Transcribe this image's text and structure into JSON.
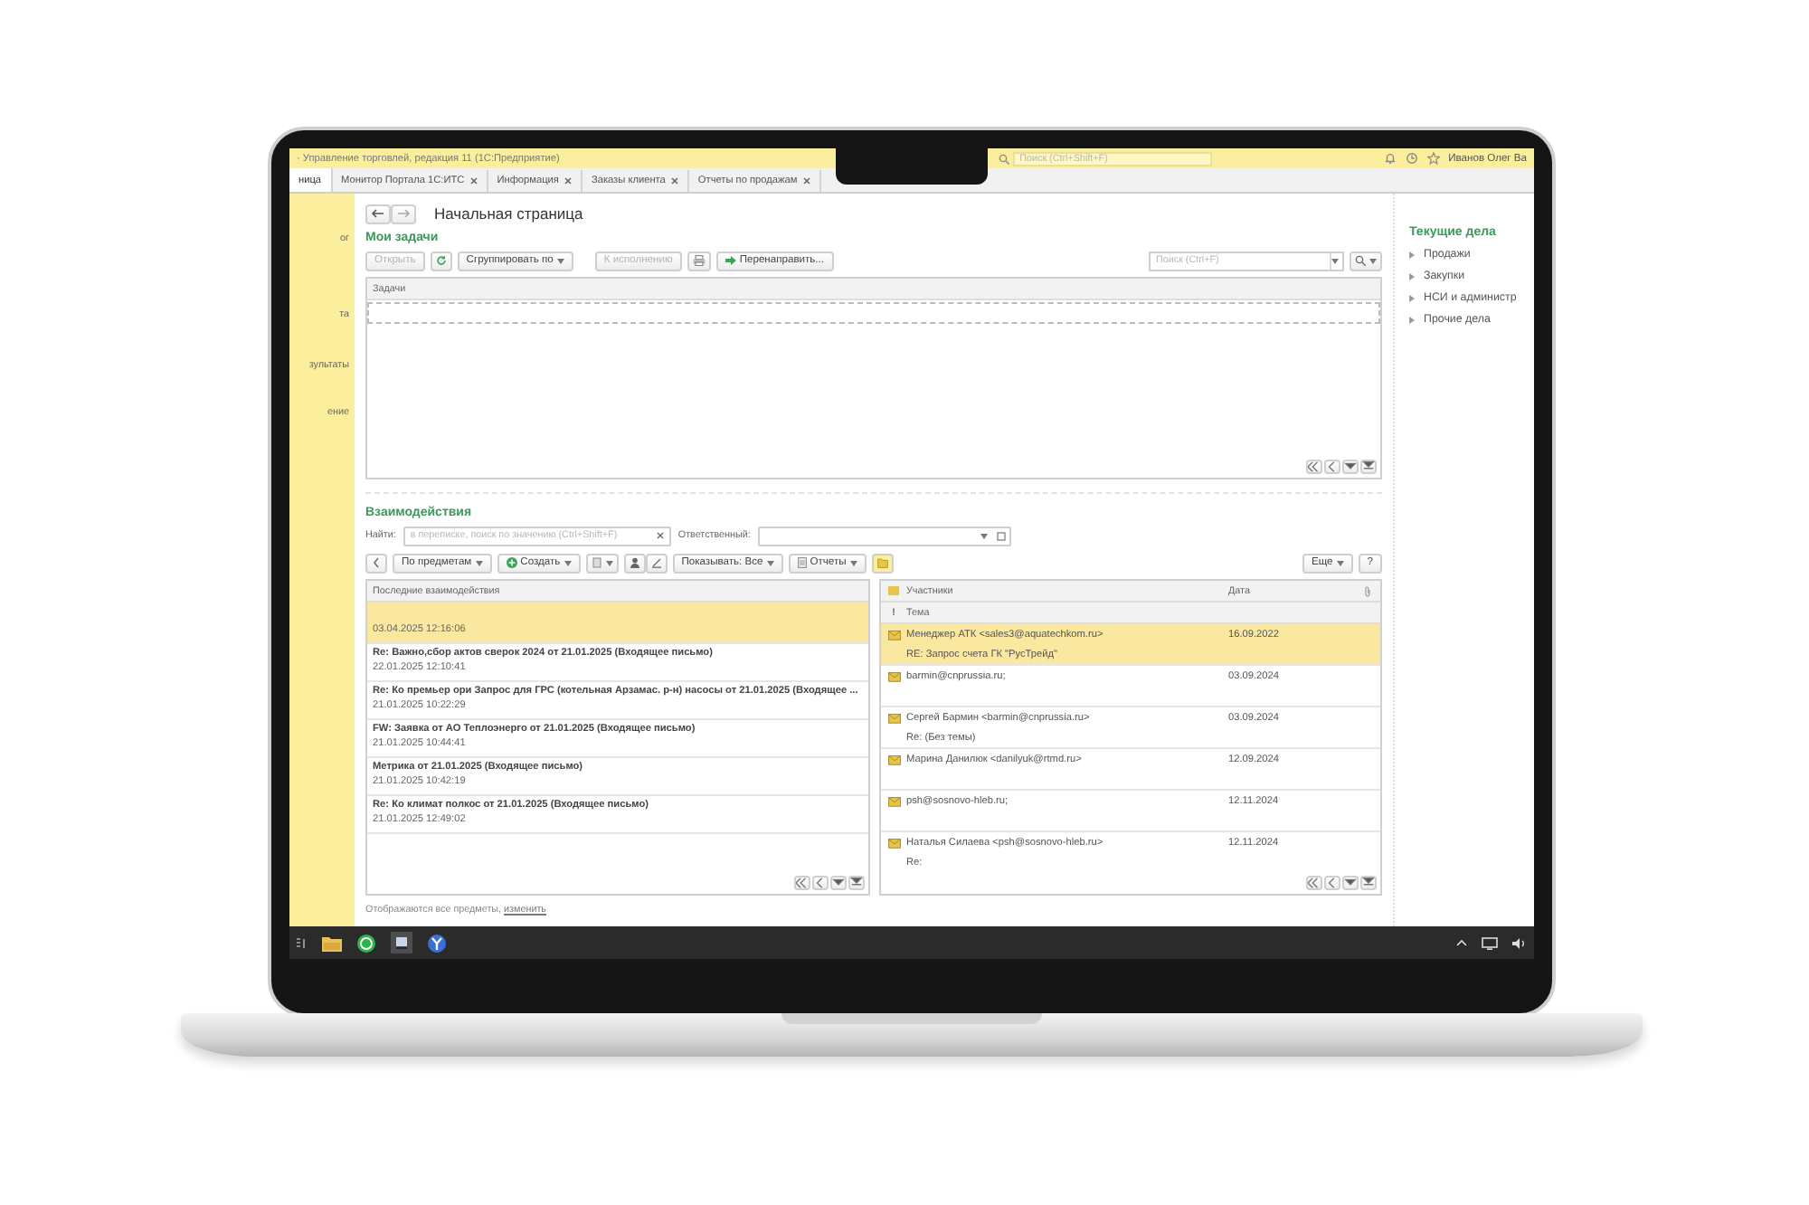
{
  "window": {
    "title": "· Управление торговлей, редакция 11  (1С:Предприятие)",
    "search_placeholder": "Поиск (Ctrl+Shift+F)",
    "user": "Иванов Олег Ва"
  },
  "tabs": [
    {
      "label": "ница",
      "selected": true,
      "closable": false
    },
    {
      "label": "Монитор Портала 1С:ИТС",
      "selected": false,
      "closable": true
    },
    {
      "label": "Информация",
      "selected": false,
      "closable": true
    },
    {
      "label": "Заказы клиента",
      "selected": false,
      "closable": true
    },
    {
      "label": "Отчеты по продажам",
      "selected": false,
      "closable": true
    }
  ],
  "sidebar": {
    "items": [
      {
        "label": "ог"
      },
      {
        "label": "та"
      },
      {
        "label": "зультаты"
      },
      {
        "label": "ение"
      }
    ]
  },
  "page": {
    "title": "Начальная страница"
  },
  "tasks": {
    "title": "Мои задачи",
    "buttons": [
      {
        "label": "Открыть",
        "disabled": true
      },
      {
        "label": "Сгруппировать по",
        "disabled": false
      },
      {
        "label": "К исполнению",
        "disabled": true
      },
      {
        "label": "Перенаправить...",
        "disabled": false
      }
    ],
    "search_placeholder": "Поиск (Ctrl+F)",
    "column": "Задачи"
  },
  "interactions": {
    "title": "Взаимодействия",
    "find_label": "Найти:",
    "find_placeholder": "в переписке, поиск по значению (Ctrl+Shift+F)",
    "responsible_label": "Ответственный:",
    "buttons": [
      {
        "label": "По предметам"
      },
      {
        "label": "Создать"
      },
      {
        "label": "Показывать: Все"
      },
      {
        "label": "Отчеты"
      },
      {
        "label": "Еще"
      },
      {
        "label": "?"
      }
    ],
    "list": {
      "column": "Последние взаимодействия",
      "items": [
        {
          "date": "03.04.2025 12:16:06",
          "selected": true
        },
        {
          "subject": "Re: Важно,сбор актов сверок 2024 от 21.01.2025 (Входящее письмо)",
          "date": "22.01.2025 12:10:41",
          "selected": false
        },
        {
          "subject": "Re: Ко премьер ори Запрос для ГРС (котельная Арзамас. р-н) насосы от 21.01.2025 (Входящее ...",
          "date": "21.01.2025 10:22:29",
          "selected": false
        },
        {
          "subject": "FW: Заявка от АО Теплоэнерго от 21.01.2025 (Входящее письмо)",
          "date": "21.01.2025 10:44:41",
          "selected": false
        },
        {
          "subject": "Метрика от 21.01.2025 (Входящее письмо)",
          "date": "21.01.2025 10:42:19",
          "selected": false
        },
        {
          "subject": "Re: Ко климат полкос от 21.01.2025 (Входящее письмо)",
          "date": "21.01.2025 12:49:02",
          "selected": false
        }
      ]
    },
    "messages": {
      "columns": {
        "participants": "Участники",
        "date": "Дата",
        "importance": "!",
        "subject": "Тема"
      },
      "rows": [
        {
          "participants": "Менеджер АТК <sales3@aquatechkom.ru>",
          "date": "16.09.2022",
          "subject": "RE: Запрос счета ГК \"РусТрейд\"",
          "selected": true
        },
        {
          "participants": "barmin@cnprussia.ru;",
          "date": "03.09.2024",
          "selected": false
        },
        {
          "participants": "Сергей Бармин <barmin@cnprussia.ru>",
          "date": "03.09.2024",
          "subject": "Re: (Без темы)",
          "selected": false
        },
        {
          "participants": "Марина Данилюк <danilyuk@rtmd.ru>",
          "date": "12.09.2024",
          "selected": false
        },
        {
          "participants": "psh@sosnovo-hleb.ru;",
          "date": "12.11.2024",
          "selected": false
        },
        {
          "participants": "Наталья Силаева <psh@sosnovo-hleb.ru>",
          "date": "12.11.2024",
          "subject": "Re:",
          "selected": false
        }
      ]
    },
    "footer": {
      "text": "Отображаются все предметы, ",
      "link": "изменить"
    }
  },
  "current": {
    "title": "Текущие дела",
    "items": [
      {
        "label": "Продажи"
      },
      {
        "label": "Закупки"
      },
      {
        "label": "НСИ и администр"
      },
      {
        "label": "Прочие дела"
      }
    ]
  }
}
